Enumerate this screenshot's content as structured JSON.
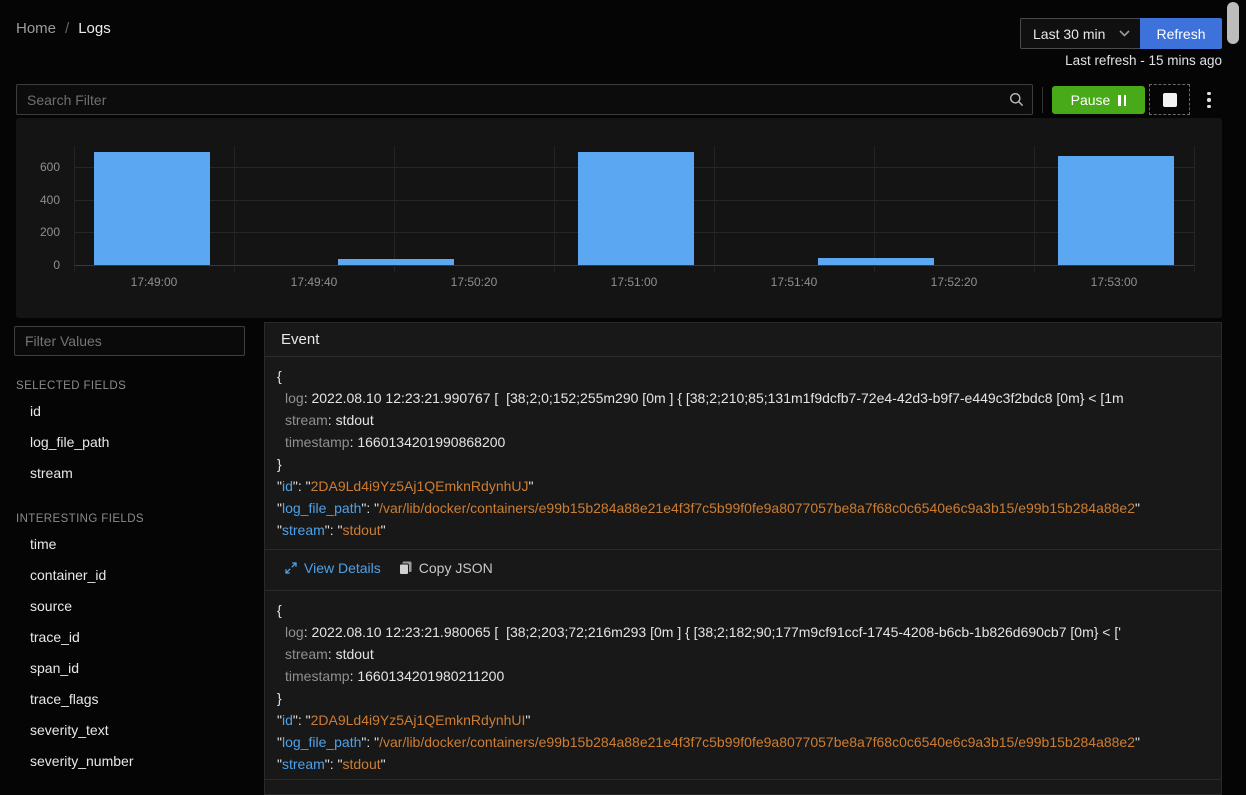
{
  "breadcrumb": {
    "home": "Home",
    "separator": "/",
    "current": "Logs"
  },
  "topbar": {
    "time_range": "Last 30 min",
    "refresh_label": "Refresh",
    "last_refresh": "Last refresh - 15 mins ago"
  },
  "search": {
    "placeholder": "Search Filter"
  },
  "controls": {
    "pause_label": "Pause"
  },
  "icons": {
    "chevron": "chevron-down-icon",
    "search": "search-icon",
    "pause": "pause-icon",
    "stop": "stop-icon",
    "kebab": "kebab-menu-icon",
    "expand": "expand-icon",
    "copy": "copy-icon"
  },
  "colors": {
    "refresh_blue": "#3c72d9",
    "pause_green": "#49aa19",
    "bar_blue": "#5ba7f2",
    "json_key_blue": "#4ea1e8",
    "json_value_orange": "#cd7d32"
  },
  "chart_data": {
    "type": "bar",
    "title": "",
    "xlabel": "",
    "ylabel": "",
    "x_range": [
      "17:48:40",
      "17:53:20"
    ],
    "x_grid_step_s": 40,
    "x_ticks": [
      "17:49:00",
      "17:49:40",
      "17:50:20",
      "17:51:00",
      "17:51:40",
      "17:52:20",
      "17:53:00"
    ],
    "y_ticks": [
      0,
      200,
      400,
      600
    ],
    "ylim": [
      0,
      900
    ],
    "grid": true,
    "legend": false,
    "bar_color": "#5ba7f2",
    "bars": [
      {
        "start": "17:48:45",
        "end": "17:49:14",
        "value": 690
      },
      {
        "start": "17:49:46",
        "end": "17:50:15",
        "value": 35
      },
      {
        "start": "17:50:46",
        "end": "17:51:15",
        "value": 690
      },
      {
        "start": "17:51:46",
        "end": "17:52:15",
        "value": 40
      },
      {
        "start": "17:52:46",
        "end": "17:53:15",
        "value": 670
      }
    ]
  },
  "sidebar": {
    "filter_placeholder": "Filter Values",
    "sections": [
      {
        "title": "SELECTED FIELDS",
        "items": [
          "id",
          "log_file_path",
          "stream"
        ]
      },
      {
        "title": "INTERESTING FIELDS",
        "items": [
          "time",
          "container_id",
          "source",
          "trace_id",
          "span_id",
          "trace_flags",
          "severity_text",
          "severity_number"
        ]
      }
    ]
  },
  "events": {
    "title": "Event",
    "actions": {
      "view_details": "View Details",
      "copy_json": "Copy JSON"
    },
    "entries": [
      {
        "show_actions": true,
        "body": [
          {
            "key": "log",
            "value": "2022.08.10 12:23:21.990767 [  [38;2;0;152;255m290 [0m ] { [38;2;210;85;131m1f9dcfb7-72e4-42d3-b9f7-e449c3f2bdc8 [0m} < [1m"
          },
          {
            "key": "stream",
            "value": "stdout"
          },
          {
            "key": "timestamp",
            "value": "1660134201990868200"
          }
        ],
        "fields": [
          {
            "key": "id",
            "value": "2DA9Ld4i9Yz5Aj1QEmknRdynhUJ"
          },
          {
            "key": "log_file_path",
            "value": "/var/lib/docker/containers/e99b15b284a88e21e4f3f7c5b99f0fe9a8077057be8a7f68c0c6540e6c9a3b15/e99b15b284a88e2"
          },
          {
            "key": "stream",
            "value": "stdout"
          }
        ]
      },
      {
        "show_actions": false,
        "body": [
          {
            "key": "log",
            "value": "2022.08.10 12:23:21.980065 [  [38;2;203;72;216m293 [0m ] { [38;2;182;90;177m9cf91ccf-1745-4208-b6cb-1b826d690cb7 [0m} < ['"
          },
          {
            "key": "stream",
            "value": "stdout"
          },
          {
            "key": "timestamp",
            "value": "1660134201980211200"
          }
        ],
        "fields": [
          {
            "key": "id",
            "value": "2DA9Ld4i9Yz5Aj1QEmknRdynhUI"
          },
          {
            "key": "log_file_path",
            "value": "/var/lib/docker/containers/e99b15b284a88e21e4f3f7c5b99f0fe9a8077057be8a7f68c0c6540e6c9a3b15/e99b15b284a88e2"
          },
          {
            "key": "stream",
            "value": "stdout"
          }
        ]
      }
    ]
  }
}
